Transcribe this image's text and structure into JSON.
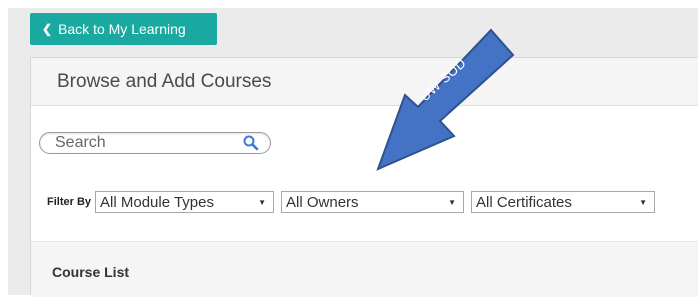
{
  "back_button": {
    "label": "Back to My Learning"
  },
  "panel": {
    "title": "Browse and Add Courses",
    "search": {
      "placeholder": "Search",
      "value": ""
    },
    "filter": {
      "label": "Filter By",
      "module_types": "All Module Types",
      "owners": "All Owners",
      "certificates": "All Certificates"
    },
    "course_list": {
      "title": "Course List"
    }
  },
  "annotation": {
    "label": "UW SOD",
    "color": "#4472c4"
  },
  "colors": {
    "accent": "#1aa9a0"
  }
}
